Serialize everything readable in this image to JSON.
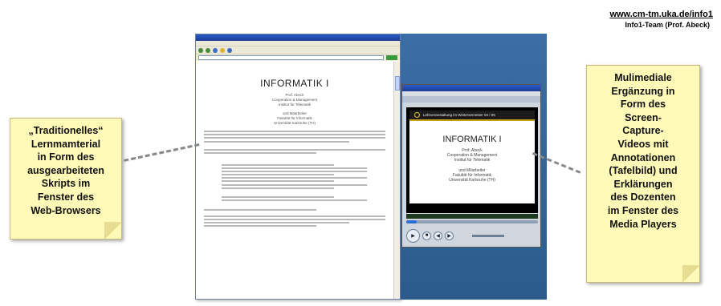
{
  "header": {
    "url": "www.cm-tm.uka.de/info1",
    "team": "Info1-Team (Prof. Abeck)"
  },
  "notes": {
    "left": [
      "„Traditionelles“",
      "Lernmamterial",
      "in Form des",
      "ausgearbeiteten",
      "Skripts im",
      "Fenster des",
      "Web-Browsers"
    ],
    "right": [
      "Mulimediale",
      "Ergänzung in",
      "Form des",
      "Screen-",
      "Capture-",
      "Videos mit",
      "Annotationen",
      "(Tafelbild) und",
      "Erklärungen",
      "des Dozenten",
      "im Fenster des",
      "Media Players"
    ]
  },
  "browser": {
    "doc_title": "INFORMATIK I",
    "doc_lines": [
      "Prof. Abeck",
      "Cooperation & Management",
      "Institut für Telematik",
      "",
      "und Mitarbeiter",
      "Fakultät für Informatik",
      "Universität Karlsruhe (TH)"
    ]
  },
  "player": {
    "header_bar": "Lehrveranstaltung im Wintersemester 04 / 05",
    "slide_title": "INFORMATIK I",
    "slide_lines": [
      "Prof. Abeck",
      "Cooperation & Management",
      "Institut für Telematik",
      "",
      "und Mitarbeiter",
      "Fakultät für Informatik",
      "Universität Karlsruhe (TH)"
    ]
  },
  "colors": {
    "note_fill": "#fffab8",
    "desktop_blue": "#3b6ea5",
    "titlebar_blue": "#2a5bc4",
    "video_accent": "#e3c430"
  }
}
